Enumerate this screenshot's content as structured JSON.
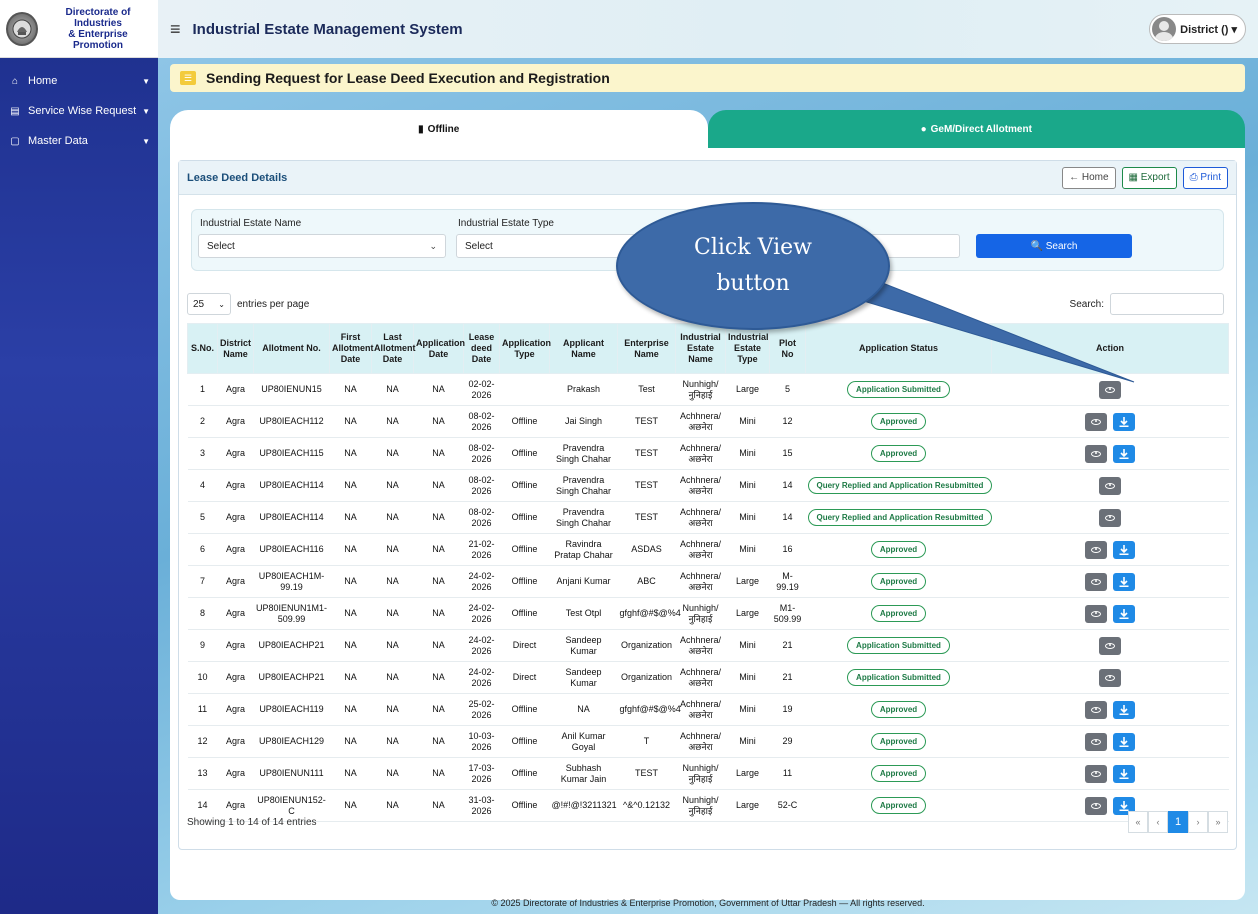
{
  "brand": {
    "line1": "Directorate of Industries",
    "line2": "& Enterprise Promotion"
  },
  "topbar": {
    "title": "Industrial Estate Management System",
    "user": "District () ▾"
  },
  "sidebar": {
    "items": [
      {
        "label": "Home",
        "icon": "⌂"
      },
      {
        "label": "Service Wise Request",
        "icon": "▤"
      },
      {
        "label": "Master Data",
        "icon": "▢"
      }
    ]
  },
  "page": {
    "title": "Sending Request for Lease Deed Execution and Registration"
  },
  "tabs": {
    "offline": "Offline",
    "gem": "GeM/Direct Allotment"
  },
  "card": {
    "title": "Lease Deed Details",
    "home_btn": "← Home",
    "export_btn": "▦ Export",
    "print_btn": "⎙ Print"
  },
  "filter": {
    "estate_name_label": "Industrial Estate Name",
    "estate_name_value": "Select",
    "estate_type_label": "Industrial Estate Type",
    "estate_type_value": "Select",
    "search_btn": "🔍 Search"
  },
  "table_controls": {
    "page_len": "25",
    "entries_label": "entries per page",
    "search_label": "Search:"
  },
  "columns": [
    "S.No.",
    "District Name",
    "Allotment No.",
    "First Allotment Date",
    "Last Allotment Date",
    "Application Date",
    "Lease deed Date",
    "Application Type",
    "Applicant Name",
    "Enterprise Name",
    "Industrial Estate Name",
    "Industrial Estate Type",
    "Plot No",
    "Application Status",
    "Action"
  ],
  "rows": [
    {
      "sno": "1",
      "district": "Agra",
      "allot": "UP80IENUN15",
      "first": "NA",
      "last": "NA",
      "appdate": "NA",
      "lease": "02-02-2026",
      "apptype": "",
      "applicant": "Prakash",
      "enterprise": "Test",
      "estate": "Nunhigh/ नुनिहाई",
      "etype": "Large",
      "plot": "5",
      "status": "Application Submitted",
      "download": false
    },
    {
      "sno": "2",
      "district": "Agra",
      "allot": "UP80IEACH112",
      "first": "NA",
      "last": "NA",
      "appdate": "NA",
      "lease": "08-02-2026",
      "apptype": "Offline",
      "applicant": "Jai Singh",
      "enterprise": "TEST",
      "estate": "Achhnera/ अछनेरा",
      "etype": "Mini",
      "plot": "12",
      "status": "Approved",
      "download": true
    },
    {
      "sno": "3",
      "district": "Agra",
      "allot": "UP80IEACH115",
      "first": "NA",
      "last": "NA",
      "appdate": "NA",
      "lease": "08-02-2026",
      "apptype": "Offline",
      "applicant": "Pravendra Singh Chahar",
      "enterprise": "TEST",
      "estate": "Achhnera/ अछनेरा",
      "etype": "Mini",
      "plot": "15",
      "status": "Approved",
      "download": true
    },
    {
      "sno": "4",
      "district": "Agra",
      "allot": "UP80IEACH114",
      "first": "NA",
      "last": "NA",
      "appdate": "NA",
      "lease": "08-02-2026",
      "apptype": "Offline",
      "applicant": "Pravendra Singh Chahar",
      "enterprise": "TEST",
      "estate": "Achhnera/ अछनेरा",
      "etype": "Mini",
      "plot": "14",
      "status": "Query Replied and Application Resubmitted",
      "download": false
    },
    {
      "sno": "5",
      "district": "Agra",
      "allot": "UP80IEACH114",
      "first": "NA",
      "last": "NA",
      "appdate": "NA",
      "lease": "08-02-2026",
      "apptype": "Offline",
      "applicant": "Pravendra Singh Chahar",
      "enterprise": "TEST",
      "estate": "Achhnera/ अछनेरा",
      "etype": "Mini",
      "plot": "14",
      "status": "Query Replied and Application Resubmitted",
      "download": false
    },
    {
      "sno": "6",
      "district": "Agra",
      "allot": "UP80IEACH116",
      "first": "NA",
      "last": "NA",
      "appdate": "NA",
      "lease": "21-02-2026",
      "apptype": "Offline",
      "applicant": "Ravindra Pratap Chahar",
      "enterprise": "ASDAS",
      "estate": "Achhnera/ अछनेरा",
      "etype": "Mini",
      "plot": "16",
      "status": "Approved",
      "download": true
    },
    {
      "sno": "7",
      "district": "Agra",
      "allot": "UP80IEACH1M-99.19",
      "first": "NA",
      "last": "NA",
      "appdate": "NA",
      "lease": "24-02-2026",
      "apptype": "Offline",
      "applicant": "Anjani Kumar",
      "enterprise": "ABC",
      "estate": "Achhnera/ अछनेरा",
      "etype": "Large",
      "plot": "M-99.19",
      "status": "Approved",
      "download": true
    },
    {
      "sno": "8",
      "district": "Agra",
      "allot": "UP80IENUN1M1-509.99",
      "first": "NA",
      "last": "NA",
      "appdate": "NA",
      "lease": "24-02-2026",
      "apptype": "Offline",
      "applicant": "Test Otpl",
      "enterprise": "gfghf@#$@%4",
      "estate": "Nunhigh/ नुनिहाई",
      "etype": "Large",
      "plot": "M1-509.99",
      "status": "Approved",
      "download": true
    },
    {
      "sno": "9",
      "district": "Agra",
      "allot": "UP80IEACHP21",
      "first": "NA",
      "last": "NA",
      "appdate": "NA",
      "lease": "24-02-2026",
      "apptype": "Direct",
      "applicant": "Sandeep Kumar",
      "enterprise": "Organization",
      "estate": "Achhnera/ अछनेरा",
      "etype": "Mini",
      "plot": "21",
      "status": "Application Submitted",
      "download": false
    },
    {
      "sno": "10",
      "district": "Agra",
      "allot": "UP80IEACHP21",
      "first": "NA",
      "last": "NA",
      "appdate": "NA",
      "lease": "24-02-2026",
      "apptype": "Direct",
      "applicant": "Sandeep Kumar",
      "enterprise": "Organization",
      "estate": "Achhnera/ अछनेरा",
      "etype": "Mini",
      "plot": "21",
      "status": "Application Submitted",
      "download": false
    },
    {
      "sno": "11",
      "district": "Agra",
      "allot": "UP80IEACH119",
      "first": "NA",
      "last": "NA",
      "appdate": "NA",
      "lease": "25-02-2026",
      "apptype": "Offline",
      "applicant": "NA",
      "enterprise": "gfghf@#$@%4",
      "estate": "Achhnera/ अछनेरा",
      "etype": "Mini",
      "plot": "19",
      "status": "Approved",
      "download": true
    },
    {
      "sno": "12",
      "district": "Agra",
      "allot": "UP80IEACH129",
      "first": "NA",
      "last": "NA",
      "appdate": "NA",
      "lease": "10-03-2026",
      "apptype": "Offline",
      "applicant": "Anil Kumar Goyal",
      "enterprise": "T",
      "estate": "Achhnera/ अछनेरा",
      "etype": "Mini",
      "plot": "29",
      "status": "Approved",
      "download": true
    },
    {
      "sno": "13",
      "district": "Agra",
      "allot": "UP80IENUN111",
      "first": "NA",
      "last": "NA",
      "appdate": "NA",
      "lease": "17-03-2026",
      "apptype": "Offline",
      "applicant": "Subhash Kumar Jain",
      "enterprise": "TEST",
      "estate": "Nunhigh/ नुनिहाई",
      "etype": "Large",
      "plot": "11",
      "status": "Approved",
      "download": true
    },
    {
      "sno": "14",
      "district": "Agra",
      "allot": "UP80IENUN152-C",
      "first": "NA",
      "last": "NA",
      "appdate": "NA",
      "lease": "31-03-2026",
      "apptype": "Offline",
      "applicant": "@!#!@!3211321",
      "enterprise": "^&^0.12132",
      "estate": "Nunhigh/ नुनिहाई",
      "etype": "Large",
      "plot": "52-C",
      "status": "Approved",
      "download": true
    }
  ],
  "info": "Showing 1 to 14 of 14 entries",
  "pager": {
    "first": "«",
    "prev": "‹",
    "current": "1",
    "next": "›",
    "last": "»"
  },
  "footer": "© 2025 Directorate of Industries & Enterprise Promotion, Government of Uttar Pradesh — All rights reserved.",
  "callout": {
    "line1": "Click View",
    "line2": "button"
  },
  "colors": {
    "sidebar": "#1d2f8c",
    "tab_gem": "#1aa88a",
    "primary": "#1565e6",
    "callout": "#3d6aa8"
  }
}
